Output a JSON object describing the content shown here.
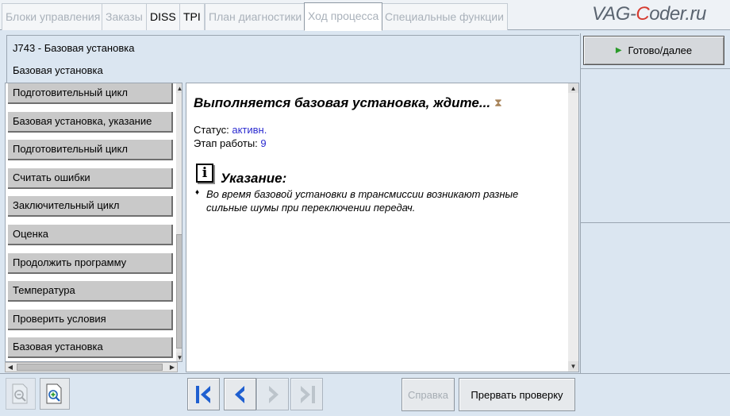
{
  "tabs": [
    {
      "label": "Блоки управления",
      "state": "disabled"
    },
    {
      "label": "Заказы",
      "state": "disabled"
    },
    {
      "label": "DISS",
      "state": "enabled"
    },
    {
      "label": "TPI",
      "state": "enabled"
    },
    {
      "label": "План диагностики",
      "state": "disabled"
    },
    {
      "label": "Ход процесса",
      "state": "active"
    },
    {
      "label": "Специальные функции",
      "state": "disabled"
    }
  ],
  "logo": {
    "part1": "VAG-",
    "part2": "C",
    "part3": "oder.ru"
  },
  "header": {
    "line1": "J743 - Базовая установка",
    "line2": "Базовая установка"
  },
  "right_panel": {
    "ready_button": "Готово/далее"
  },
  "test_list": [
    "Подготовительный цикл",
    "Базовая установка, указание",
    "Подготовительный цикл",
    "Считать ошибки",
    "Заключительный цикл",
    "Оценка",
    "Продолжить программу",
    "Температура",
    "Проверить условия",
    "Базовая установка"
  ],
  "content": {
    "title": "Выполняется базовая установка, ждите...",
    "status_label": "Статус:",
    "status_value": "активн.",
    "stage_label": "Этап работы:",
    "stage_value": "9",
    "note_icon_letter": "i",
    "note_title": "Указание:",
    "note_text": "Во время базовой установки в трансмиссии возникают разные сильные шумы при переключении передач."
  },
  "bottom": {
    "help_button": "Справка",
    "abort_button": "Прервать проверку"
  },
  "colors": {
    "accent_blue": "#1f5fd0",
    "value_blue": "#2b2bd0",
    "ready_arrow": "#2a9a2a",
    "logo_red": "#d63a2f"
  }
}
